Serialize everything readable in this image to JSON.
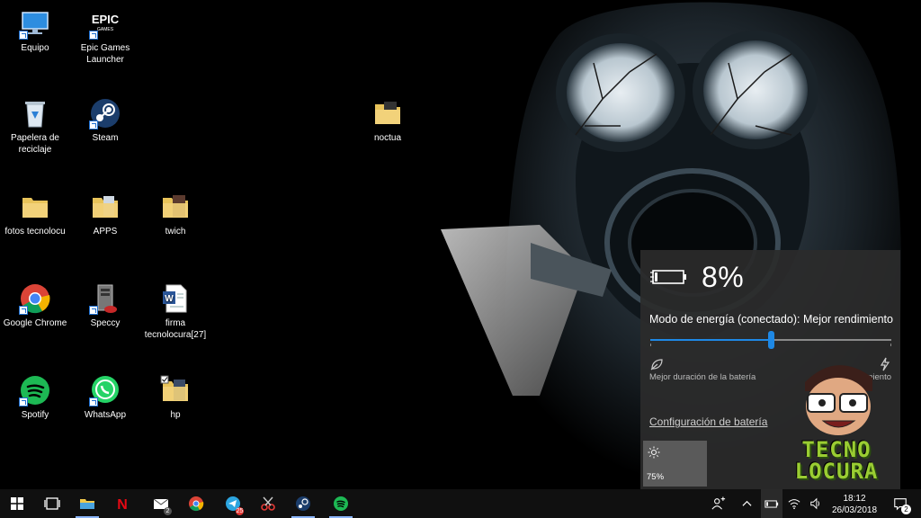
{
  "desktop": {
    "icons": [
      {
        "label": "Equipo",
        "icon": "computer-icon"
      },
      {
        "label": "Epic Games Launcher",
        "icon": "epic-games-icon",
        "logo_text": "EPIC"
      },
      {
        "label": "Papelera de reciclaje",
        "icon": "recycle-bin-icon"
      },
      {
        "label": "Steam",
        "icon": "steam-icon"
      },
      {
        "label": "noctua",
        "icon": "folder-icon"
      },
      {
        "label": "fotos tecnolocu",
        "icon": "folder-icon"
      },
      {
        "label": "APPS",
        "icon": "folder-icon"
      },
      {
        "label": "twich",
        "icon": "folder-icon"
      },
      {
        "label": "Google Chrome",
        "icon": "chrome-icon"
      },
      {
        "label": "Speccy",
        "icon": "speccy-icon"
      },
      {
        "label": "firma tecnolocura[27]",
        "icon": "word-document-icon"
      },
      {
        "label": "Spotify",
        "icon": "spotify-icon"
      },
      {
        "label": "WhatsApp",
        "icon": "whatsapp-icon"
      },
      {
        "label": "hp",
        "icon": "folder-icon"
      }
    ]
  },
  "battery": {
    "percent_text": "8%",
    "mode_label": "Modo de energía (conectado): Mejor rendimiento",
    "slider_level": 0.5,
    "left_caption": "Mejor duración de la batería",
    "right_caption": "Mejor rendimiento",
    "settings_link": "Configuración de batería",
    "brightness_text": "75%",
    "accent": "#1e88e5"
  },
  "watermark": {
    "line1": "TECNO",
    "line2": "LOCURA"
  },
  "taskbar": {
    "apps": [
      {
        "name": "task-view-icon"
      },
      {
        "name": "file-explorer-icon"
      },
      {
        "name": "netflix-icon",
        "text": "N"
      },
      {
        "name": "mail-icon",
        "badge": "2"
      },
      {
        "name": "chrome-icon"
      },
      {
        "name": "telegram-icon",
        "badge": "25"
      },
      {
        "name": "snipping-tool-icon"
      },
      {
        "name": "steam-icon"
      },
      {
        "name": "spotify-icon"
      }
    ],
    "clock": {
      "time": "18:12",
      "date": "26/03/2018"
    },
    "notification_badge": "2"
  }
}
